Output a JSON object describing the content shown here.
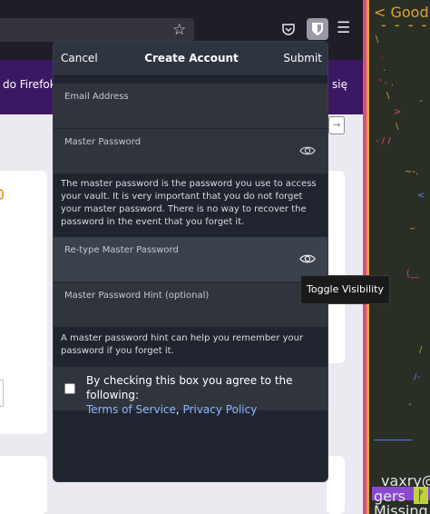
{
  "browser": {
    "banner_text": "do Firefok",
    "banner_suffix": "się"
  },
  "popup": {
    "header": {
      "cancel_label": "Cancel",
      "title": "Create Account",
      "submit_label": "Submit"
    },
    "fields": {
      "email": {
        "label": "Email Address",
        "value": ""
      },
      "master_password": {
        "label": "Master Password",
        "value": ""
      },
      "retype_password": {
        "label": "Re-type Master Password",
        "value": ""
      },
      "hint": {
        "label": "Master Password Hint (optional)",
        "value": ""
      }
    },
    "master_help": "The master password is the password you use to access your vault. It is very important that you do not forget your master password. There is no way to recover the password in the event that you forget it.",
    "hint_help": "A master password hint can help you remember your password if you forget it.",
    "terms": {
      "prefix": "By checking this box you agree to the following:",
      "tos_link": "Terms of Service",
      "separator": ", ",
      "privacy_link": "Privacy Policy"
    }
  },
  "tooltip": {
    "text": "Toggle Visibility"
  },
  "terminal": {
    "top_line": "< Good e",
    "user_line": "vaxry@A",
    "branch": "gers",
    "missing": "Missing"
  },
  "colors": {
    "popup_bg": "#1f242e",
    "field_bg": "#2f343d",
    "link": "#8eb6ff",
    "banner": "#3b1862"
  }
}
